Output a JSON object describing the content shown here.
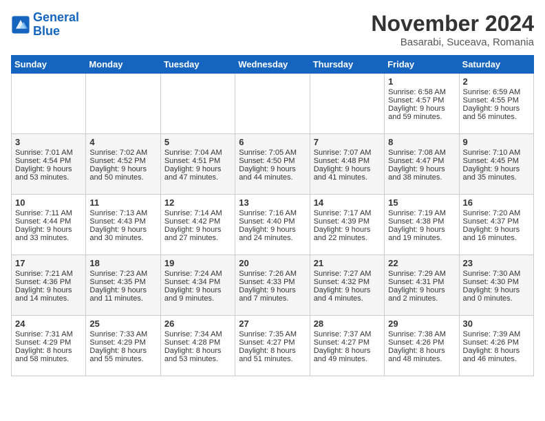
{
  "header": {
    "logo_line1": "General",
    "logo_line2": "Blue",
    "month": "November 2024",
    "location": "Basarabi, Suceava, Romania"
  },
  "days_of_week": [
    "Sunday",
    "Monday",
    "Tuesday",
    "Wednesday",
    "Thursday",
    "Friday",
    "Saturday"
  ],
  "weeks": [
    [
      {
        "day": "",
        "info": ""
      },
      {
        "day": "",
        "info": ""
      },
      {
        "day": "",
        "info": ""
      },
      {
        "day": "",
        "info": ""
      },
      {
        "day": "",
        "info": ""
      },
      {
        "day": "1",
        "info": "Sunrise: 6:58 AM\nSunset: 4:57 PM\nDaylight: 9 hours and 59 minutes."
      },
      {
        "day": "2",
        "info": "Sunrise: 6:59 AM\nSunset: 4:55 PM\nDaylight: 9 hours and 56 minutes."
      }
    ],
    [
      {
        "day": "3",
        "info": "Sunrise: 7:01 AM\nSunset: 4:54 PM\nDaylight: 9 hours and 53 minutes."
      },
      {
        "day": "4",
        "info": "Sunrise: 7:02 AM\nSunset: 4:52 PM\nDaylight: 9 hours and 50 minutes."
      },
      {
        "day": "5",
        "info": "Sunrise: 7:04 AM\nSunset: 4:51 PM\nDaylight: 9 hours and 47 minutes."
      },
      {
        "day": "6",
        "info": "Sunrise: 7:05 AM\nSunset: 4:50 PM\nDaylight: 9 hours and 44 minutes."
      },
      {
        "day": "7",
        "info": "Sunrise: 7:07 AM\nSunset: 4:48 PM\nDaylight: 9 hours and 41 minutes."
      },
      {
        "day": "8",
        "info": "Sunrise: 7:08 AM\nSunset: 4:47 PM\nDaylight: 9 hours and 38 minutes."
      },
      {
        "day": "9",
        "info": "Sunrise: 7:10 AM\nSunset: 4:45 PM\nDaylight: 9 hours and 35 minutes."
      }
    ],
    [
      {
        "day": "10",
        "info": "Sunrise: 7:11 AM\nSunset: 4:44 PM\nDaylight: 9 hours and 33 minutes."
      },
      {
        "day": "11",
        "info": "Sunrise: 7:13 AM\nSunset: 4:43 PM\nDaylight: 9 hours and 30 minutes."
      },
      {
        "day": "12",
        "info": "Sunrise: 7:14 AM\nSunset: 4:42 PM\nDaylight: 9 hours and 27 minutes."
      },
      {
        "day": "13",
        "info": "Sunrise: 7:16 AM\nSunset: 4:40 PM\nDaylight: 9 hours and 24 minutes."
      },
      {
        "day": "14",
        "info": "Sunrise: 7:17 AM\nSunset: 4:39 PM\nDaylight: 9 hours and 22 minutes."
      },
      {
        "day": "15",
        "info": "Sunrise: 7:19 AM\nSunset: 4:38 PM\nDaylight: 9 hours and 19 minutes."
      },
      {
        "day": "16",
        "info": "Sunrise: 7:20 AM\nSunset: 4:37 PM\nDaylight: 9 hours and 16 minutes."
      }
    ],
    [
      {
        "day": "17",
        "info": "Sunrise: 7:21 AM\nSunset: 4:36 PM\nDaylight: 9 hours and 14 minutes."
      },
      {
        "day": "18",
        "info": "Sunrise: 7:23 AM\nSunset: 4:35 PM\nDaylight: 9 hours and 11 minutes."
      },
      {
        "day": "19",
        "info": "Sunrise: 7:24 AM\nSunset: 4:34 PM\nDaylight: 9 hours and 9 minutes."
      },
      {
        "day": "20",
        "info": "Sunrise: 7:26 AM\nSunset: 4:33 PM\nDaylight: 9 hours and 7 minutes."
      },
      {
        "day": "21",
        "info": "Sunrise: 7:27 AM\nSunset: 4:32 PM\nDaylight: 9 hours and 4 minutes."
      },
      {
        "day": "22",
        "info": "Sunrise: 7:29 AM\nSunset: 4:31 PM\nDaylight: 9 hours and 2 minutes."
      },
      {
        "day": "23",
        "info": "Sunrise: 7:30 AM\nSunset: 4:30 PM\nDaylight: 9 hours and 0 minutes."
      }
    ],
    [
      {
        "day": "24",
        "info": "Sunrise: 7:31 AM\nSunset: 4:29 PM\nDaylight: 8 hours and 58 minutes."
      },
      {
        "day": "25",
        "info": "Sunrise: 7:33 AM\nSunset: 4:29 PM\nDaylight: 8 hours and 55 minutes."
      },
      {
        "day": "26",
        "info": "Sunrise: 7:34 AM\nSunset: 4:28 PM\nDaylight: 8 hours and 53 minutes."
      },
      {
        "day": "27",
        "info": "Sunrise: 7:35 AM\nSunset: 4:27 PM\nDaylight: 8 hours and 51 minutes."
      },
      {
        "day": "28",
        "info": "Sunrise: 7:37 AM\nSunset: 4:27 PM\nDaylight: 8 hours and 49 minutes."
      },
      {
        "day": "29",
        "info": "Sunrise: 7:38 AM\nSunset: 4:26 PM\nDaylight: 8 hours and 48 minutes."
      },
      {
        "day": "30",
        "info": "Sunrise: 7:39 AM\nSunset: 4:26 PM\nDaylight: 8 hours and 46 minutes."
      }
    ]
  ]
}
